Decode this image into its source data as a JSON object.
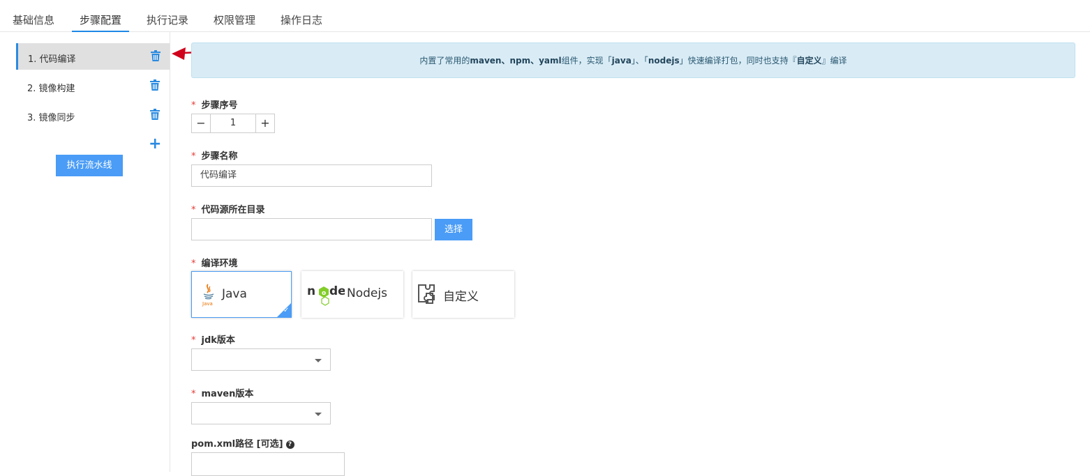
{
  "tabs": [
    "基础信息",
    "步骤配置",
    "执行记录",
    "权限管理",
    "操作日志"
  ],
  "steps": [
    {
      "label": "1. 代码编译"
    },
    {
      "label": "2. 镜像构建"
    },
    {
      "label": "3. 镜像同步"
    }
  ],
  "sidebar": {
    "add_icon": "plus-icon",
    "run_label": "执行流水线",
    "trash_icon": "trash-icon"
  },
  "info": {
    "p1": "内置了常用的",
    "b1": "maven、npm、yaml",
    "p2": "组件，实现「",
    "b2": "java",
    "p3": "」、「",
    "b3": "nodejs",
    "p4": "」快速编译打包，同时也支持『",
    "b4": "自定义",
    "p5": "』编译"
  },
  "form": {
    "step_no_label": "步骤序号",
    "step_no_value": "1",
    "step_name_label": "步骤名称",
    "step_name_value": "代码编译",
    "src_dir_label": "代码源所在目录",
    "src_dir_value": "",
    "select_btn": "选择",
    "env_label": "编译环境",
    "envs": [
      {
        "name": "Java",
        "icon": "java-icon"
      },
      {
        "name": "Nodejs",
        "icon": "nodejs-icon"
      },
      {
        "name": "自定义",
        "icon": "puzzle-icon"
      }
    ],
    "jdk_label": "jdk版本",
    "jdk_value": "",
    "maven_label": "maven版本",
    "maven_value": "",
    "pom_label": "pom.xml路径 [可选]",
    "pom_value": "",
    "star": "*"
  },
  "colors": {
    "accent": "#4a9cf6",
    "required": "#e53935",
    "info_bg": "#d9ecf6",
    "arrow": "#d0021b"
  }
}
